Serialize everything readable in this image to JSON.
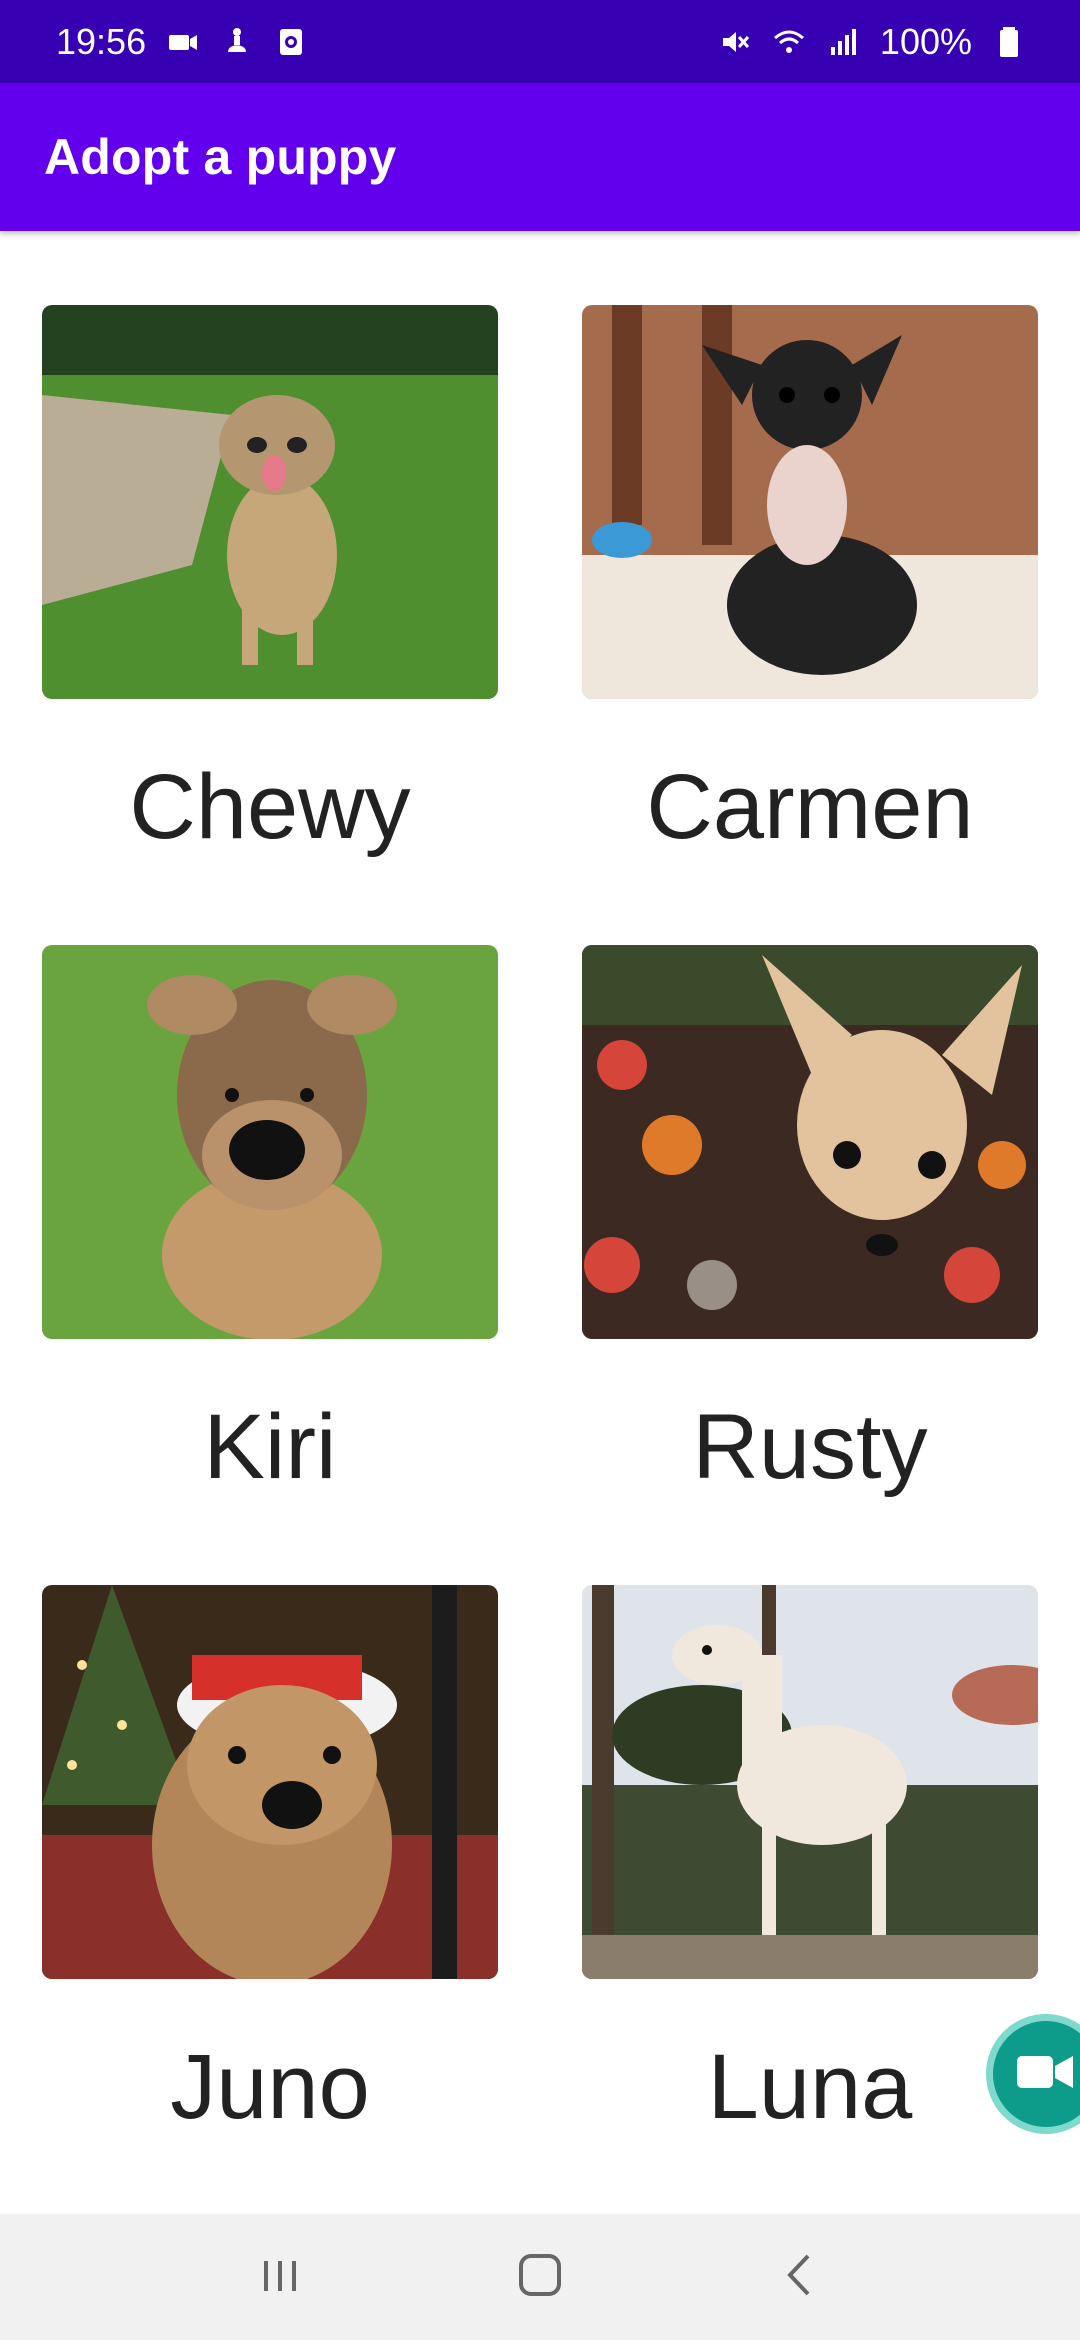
{
  "status_bar": {
    "time": "19:56",
    "battery": "100%",
    "left_icons": [
      "video-icon",
      "accessibility-icon",
      "screen-record-icon"
    ],
    "right_icons": [
      "mute-icon",
      "wifi-icon",
      "signal-icon",
      "battery-icon"
    ]
  },
  "app_bar": {
    "title": "Adopt a puppy",
    "color": "#6200ee"
  },
  "puppies": [
    {
      "name": "Chewy"
    },
    {
      "name": "Carmen"
    },
    {
      "name": "Kiri"
    },
    {
      "name": "Rusty"
    },
    {
      "name": "Juno"
    },
    {
      "name": "Luna"
    }
  ],
  "fab": {
    "icon": "video-call-icon",
    "color": "#0d9b8a"
  },
  "nav_bar": {
    "buttons": [
      "recent-apps-icon",
      "home-icon",
      "back-icon"
    ]
  }
}
